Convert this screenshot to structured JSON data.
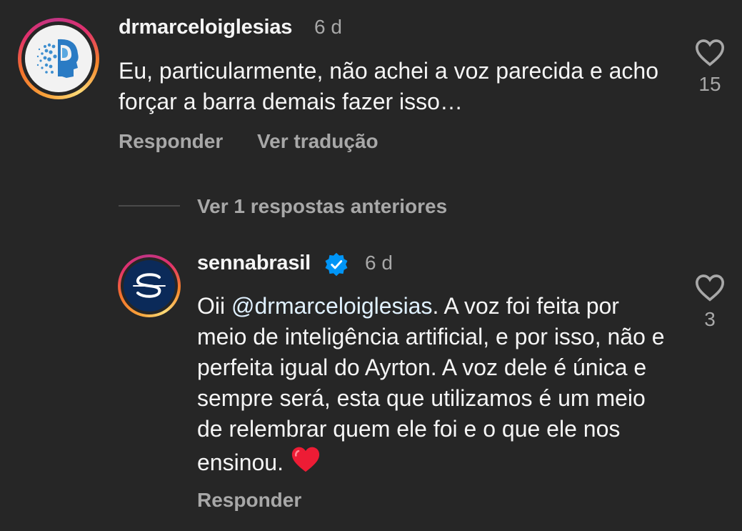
{
  "comment1": {
    "username": "drmarceloiglesias",
    "time": "6 d",
    "text": "Eu, particularmente, não achei a voz parecida e acho forçar a barra demais fazer isso…",
    "likes": "15",
    "reply_label": "Responder",
    "translate_label": "Ver tradução"
  },
  "replies_toggle": {
    "label": "Ver 1 respostas anteriores"
  },
  "reply1": {
    "username": "sennabrasil",
    "verified": true,
    "time": "6 d",
    "mention": "@drmarceloiglesias",
    "text_before_mention": "Oii ",
    "text_after_mention": ". A voz foi feita por meio de inteligência artificial, e por isso, não e perfeita igual do Ayrton. A voz dele é única e sempre será, esta que utilizamos é um meio de relembrar quem ele foi e o que ele nos ensinou. ",
    "likes": "3",
    "reply_label": "Responder"
  },
  "colors": {
    "background": "#262626",
    "primary_text": "#f5f5f5",
    "secondary_text": "#a8a8a8",
    "verified_badge": "#0095f6",
    "heart_emoji": "#ed1c35"
  }
}
